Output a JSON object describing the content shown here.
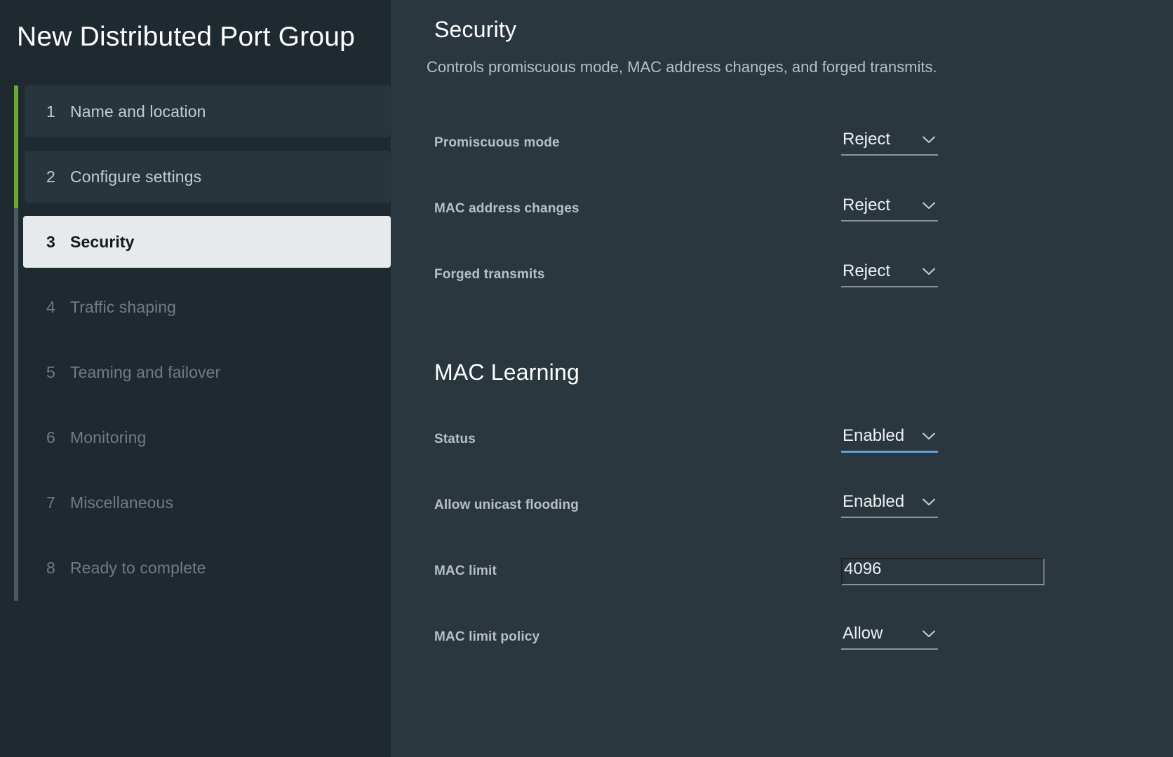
{
  "wizard": {
    "title": "New Distributed Port Group",
    "steps": [
      {
        "num": "1",
        "label": "Name and location",
        "state": "done"
      },
      {
        "num": "2",
        "label": "Configure settings",
        "state": "done"
      },
      {
        "num": "3",
        "label": "Security",
        "state": "active"
      },
      {
        "num": "4",
        "label": "Traffic shaping",
        "state": "todo"
      },
      {
        "num": "5",
        "label": "Teaming and failover",
        "state": "todo"
      },
      {
        "num": "6",
        "label": "Monitoring",
        "state": "todo"
      },
      {
        "num": "7",
        "label": "Miscellaneous",
        "state": "todo"
      },
      {
        "num": "8",
        "label": "Ready to complete",
        "state": "todo"
      }
    ]
  },
  "page": {
    "title": "Security",
    "description": "Controls promiscuous mode, MAC address changes, and forged transmits."
  },
  "security": {
    "promiscuous_mode": {
      "label": "Promiscuous mode",
      "value": "Reject"
    },
    "mac_address_changes": {
      "label": "MAC address changes",
      "value": "Reject"
    },
    "forged_transmits": {
      "label": "Forged transmits",
      "value": "Reject"
    }
  },
  "mac_learning": {
    "section_title": "MAC Learning",
    "status": {
      "label": "Status",
      "value": "Enabled"
    },
    "allow_unicast_flooding": {
      "label": "Allow unicast flooding",
      "value": "Enabled"
    },
    "mac_limit": {
      "label": "MAC limit",
      "value": "4096"
    },
    "mac_limit_policy": {
      "label": "MAC limit policy",
      "value": "Allow"
    }
  },
  "colors": {
    "sidebar_bg": "#1e2a30",
    "main_bg": "#2a373e",
    "progress_green": "#6aac2f",
    "rail_track": "#4a5a60",
    "active_step_bg": "#e6eaed",
    "focus_blue": "#5aa3d6",
    "underline_gray": "#8a9599"
  },
  "icons": {
    "chevron_down": "chevron-down-icon"
  }
}
